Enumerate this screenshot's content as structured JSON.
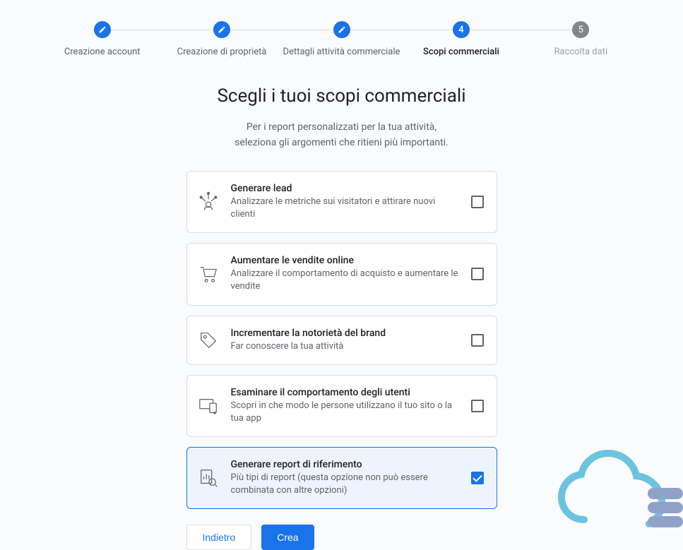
{
  "stepper": {
    "steps": [
      {
        "label": "Creazione account",
        "state": "done"
      },
      {
        "label": "Creazione di proprietà",
        "state": "done"
      },
      {
        "label": "Dettagli attività commerciale",
        "state": "done"
      },
      {
        "label": "Scopi commerciali",
        "state": "current",
        "number": "4"
      },
      {
        "label": "Raccolta dati",
        "state": "future",
        "number": "5"
      }
    ]
  },
  "main": {
    "title": "Scegli i tuoi scopi commerciali",
    "subtitle_line1": "Per i report personalizzati per la tua attività,",
    "subtitle_line2": "seleziona gli argomenti che ritieni più importanti."
  },
  "options": [
    {
      "title": "Generare lead",
      "desc": "Analizzare le metriche sui visitatori e attirare nuovi clienti",
      "checked": false
    },
    {
      "title": "Aumentare le vendite online",
      "desc": "Analizzare il comportamento di acquisto e aumentare le vendite",
      "checked": false
    },
    {
      "title": "Incrementare la notorietà del brand",
      "desc": "Far conoscere la tua attività",
      "checked": false
    },
    {
      "title": "Esaminare il comportamento degli utenti",
      "desc": "Scopri in che modo le persone utilizzano il tuo sito o la tua app",
      "checked": false
    },
    {
      "title": "Generare report di riferimento",
      "desc": "Più tipi di report (questa opzione non può essere combinata con altre opzioni)",
      "checked": true
    }
  ],
  "footer": {
    "back": "Indietro",
    "create": "Crea"
  }
}
